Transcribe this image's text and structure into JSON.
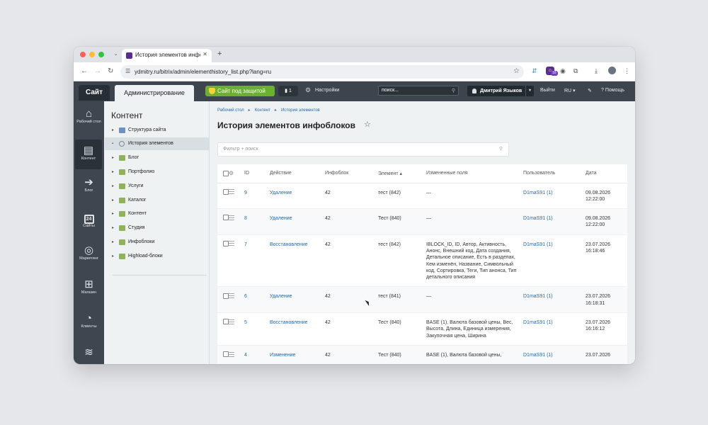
{
  "browser": {
    "tab_title": "История элементов инфобл",
    "url": "ydmitry.ru/bitrix/admin/elementhistory_list.php?lang=ru",
    "ext_badge": "16"
  },
  "admin": {
    "site_label": "Сайт",
    "admin_label": "Администрирование",
    "security_label": "Сайт под защитой",
    "notif_count": "1",
    "settings_label": "Настройки",
    "search_placeholder": "поиск...",
    "user_name": "Дмитрий Языков",
    "logout_label": "Выйти",
    "lang_label": "RU",
    "help_label": "Помощь"
  },
  "leftnav": [
    {
      "label": "Рабочий стол",
      "icon": "home-icon"
    },
    {
      "label": "Контент",
      "icon": "document-icon"
    },
    {
      "label": "Блог",
      "icon": "arrow-circle-icon"
    },
    {
      "label": "Сайты",
      "icon": "calendar-24-icon",
      "cal": "24"
    },
    {
      "label": "Маркетинг",
      "icon": "target-icon"
    },
    {
      "label": "Магазин",
      "icon": "basket-icon"
    },
    {
      "label": "Клиенты",
      "icon": "clients-24-icon"
    },
    {
      "label": "",
      "icon": "layers-icon"
    }
  ],
  "tree": {
    "title": "Контент",
    "items": [
      {
        "label": "Структура сайта"
      },
      {
        "label": "История элементов"
      },
      {
        "label": "Блог"
      },
      {
        "label": "Портфолио"
      },
      {
        "label": "Услуги"
      },
      {
        "label": "Каталог"
      },
      {
        "label": "Контент"
      },
      {
        "label": "Студия"
      },
      {
        "label": "Инфоблоки"
      },
      {
        "label": "Highload-блоки"
      }
    ]
  },
  "page": {
    "breadcrumbs": [
      "Рабочий стол",
      "Контент",
      "История элементов"
    ],
    "title": "История элементов инфоблоков",
    "filter_placeholder": "Фильтр + поиск"
  },
  "table": {
    "columns": [
      "ID",
      "Действие",
      "Инфоблок",
      "Элемент",
      "Измененные поля",
      "Пользователь",
      "Дата"
    ],
    "sort_mark": "▴",
    "rows": [
      {
        "id": "9",
        "action": "Удаление",
        "iblock": "42",
        "element": "тест (842)",
        "fields": "—",
        "user": "D1maS91 (1)",
        "date": "09.08.2026 12:22:00"
      },
      {
        "id": "8",
        "action": "Удаление",
        "iblock": "42",
        "element": "Тест (840)",
        "fields": "—",
        "user": "D1maS91 (1)",
        "date": "09.08.2026 12:22:00"
      },
      {
        "id": "7",
        "action": "Восстановление",
        "iblock": "42",
        "element": "тест (842)",
        "fields": "IBLOCK_ID, ID, Автор, Активность, Анонс, Внешний код, Дата создания, Детальное описание, Есть в разделах, Кем изменён, Название, Символьный код, Сортировка, Теги, Тип анонса, Тип детального описания",
        "user": "D1maS91 (1)",
        "date": "23.07.2026 16:18:46"
      },
      {
        "id": "6",
        "action": "Удаление",
        "iblock": "42",
        "element": "тест (841)",
        "fields": "—",
        "user": "D1maS91 (1)",
        "date": "23.07.2026 16:18:31"
      },
      {
        "id": "5",
        "action": "Восстановление",
        "iblock": "42",
        "element": "Тест (840)",
        "fields": "BASE (1), Валюта базовой цены, Вес, Высота, Длина, Единица измерения, Закупочная цена, Ширина",
        "user": "D1maS91 (1)",
        "date": "23.07.2026 16:16:12"
      },
      {
        "id": "4",
        "action": "Изменение",
        "iblock": "42",
        "element": "Тест (840)",
        "fields": "BASE (1), Валюта базовой цены,",
        "user": "D1maS91 (1)",
        "date": "23.07.2026"
      }
    ]
  }
}
